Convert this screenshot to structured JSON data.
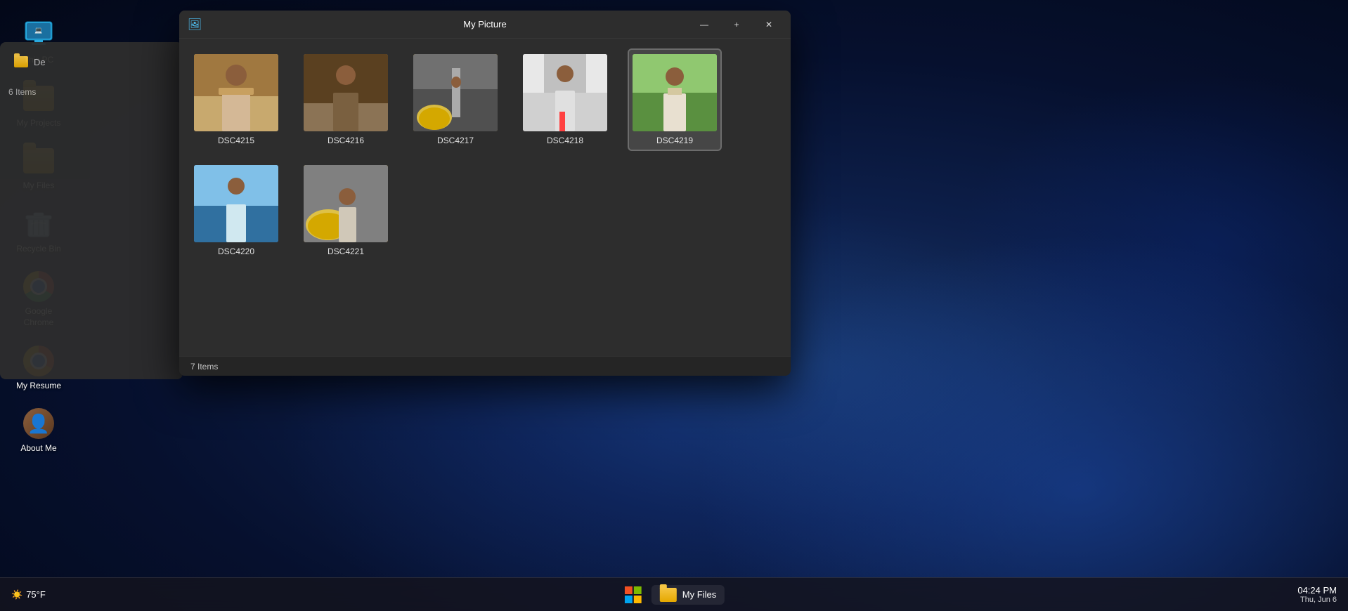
{
  "desktop": {
    "icons": [
      {
        "id": "this-pc",
        "label": "This PC",
        "type": "monitor"
      },
      {
        "id": "my-projects",
        "label": "My Projects",
        "type": "folder-yellow"
      },
      {
        "id": "my-files",
        "label": "My Files",
        "type": "folder-yellow"
      },
      {
        "id": "recycle-bin",
        "label": "Recycle Bin",
        "type": "recycle"
      },
      {
        "id": "google-chrome",
        "label": "Google Chrome",
        "type": "chrome"
      },
      {
        "id": "my-resume",
        "label": "My Resume",
        "type": "chrome-orange"
      },
      {
        "id": "about-me",
        "label": "About Me",
        "type": "avatar"
      }
    ]
  },
  "window": {
    "title": "My Picture",
    "icon": "🖼",
    "controls": {
      "minimize": "—",
      "maximize": "+",
      "close": "✕"
    }
  },
  "photos": [
    {
      "id": "dsc4215",
      "name": "DSC4215",
      "selected": false
    },
    {
      "id": "dsc4216",
      "name": "DSC4216",
      "selected": false
    },
    {
      "id": "dsc4217",
      "name": "DSC4217",
      "selected": false
    },
    {
      "id": "dsc4218",
      "name": "DSC4218",
      "selected": false
    },
    {
      "id": "dsc4219",
      "name": "DSC4219",
      "selected": true
    },
    {
      "id": "dsc4220",
      "name": "DSC4220",
      "selected": false
    },
    {
      "id": "dsc4221",
      "name": "DSC4221",
      "selected": false
    }
  ],
  "status": {
    "item_count": "7 Items"
  },
  "bg_panel": {
    "label": "De",
    "item_count": "6 Items"
  },
  "taskbar": {
    "win_button": "⊞",
    "folder_label": "My Files",
    "time": "04:24 PM",
    "date": "Thu, Jun 6",
    "weather": "75°F"
  }
}
